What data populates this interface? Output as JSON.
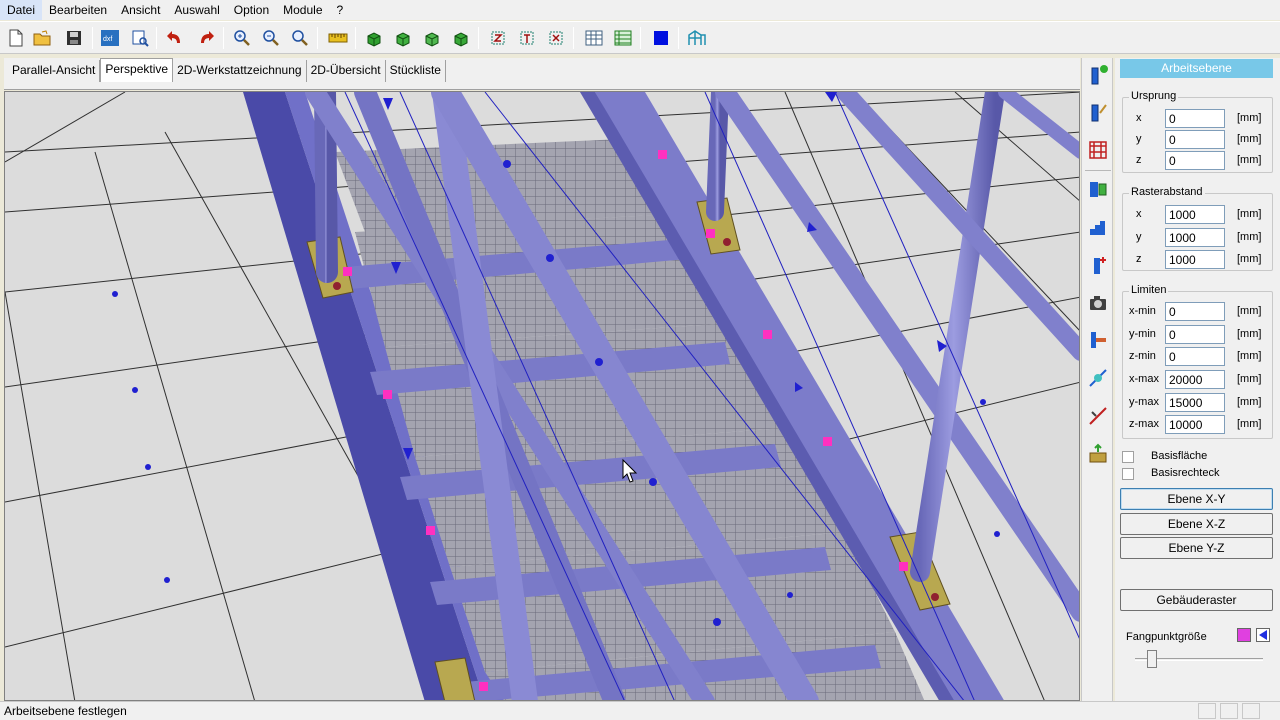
{
  "menu": [
    "Datei",
    "Bearbeiten",
    "Ansicht",
    "Auswahl",
    "Option",
    "Module",
    "?"
  ],
  "tabs": [
    {
      "label": "Parallel-Ansicht",
      "active": false
    },
    {
      "label": "Perspektive",
      "active": true
    },
    {
      "label": "2D-Werkstattzeichnung",
      "active": false
    },
    {
      "label": "2D-Übersicht",
      "active": false
    },
    {
      "label": "Stückliste",
      "active": false
    }
  ],
  "toolbar_icons": [
    "new-file-icon",
    "open-folder-icon",
    "save-icon",
    "dxf-export-icon",
    "print-preview-icon",
    "undo-icon",
    "redo-icon",
    "zoom-in-icon",
    "zoom-out-icon",
    "zoom-fit-icon",
    "measure-icon",
    "view-cube-1-icon",
    "view-cube-2-icon",
    "view-cube-3-icon",
    "view-cube-4-icon",
    "select-mode-1-icon",
    "select-mode-2-icon",
    "select-mode-3-icon",
    "table-grid-icon",
    "table-list-icon",
    "color-blue-icon",
    "structure-icon"
  ],
  "vertical_icons": [
    "beam-add-icon",
    "beam-edit-icon",
    "grid-icon",
    "profile-icon",
    "stair-icon",
    "column-add-icon",
    "camera-icon",
    "connection-icon",
    "snap-icon",
    "line-cut-icon",
    "export-icon"
  ],
  "panel": {
    "header": "Arbeitsebene",
    "origin": {
      "title": "Ursprung",
      "rows": [
        {
          "label": "x",
          "value": "0",
          "unit": "[mm]"
        },
        {
          "label": "y",
          "value": "0",
          "unit": "[mm]"
        },
        {
          "label": "z",
          "value": "0",
          "unit": "[mm]"
        }
      ]
    },
    "raster": {
      "title": "Rasterabstand",
      "rows": [
        {
          "label": "x",
          "value": "1000",
          "unit": "[mm]"
        },
        {
          "label": "y",
          "value": "1000",
          "unit": "[mm]"
        },
        {
          "label": "z",
          "value": "1000",
          "unit": "[mm]"
        }
      ]
    },
    "limits": {
      "title": "Limiten",
      "rows": [
        {
          "label": "x-min",
          "value": "0",
          "unit": "[mm]"
        },
        {
          "label": "y-min",
          "value": "0",
          "unit": "[mm]"
        },
        {
          "label": "z-min",
          "value": "0",
          "unit": "[mm]"
        },
        {
          "label": "x-max",
          "value": "20000",
          "unit": "[mm]"
        },
        {
          "label": "y-max",
          "value": "15000",
          "unit": "[mm]"
        },
        {
          "label": "z-max",
          "value": "10000",
          "unit": "[mm]"
        }
      ]
    },
    "checkboxes": [
      {
        "label": "Basisfläche",
        "checked": false
      },
      {
        "label": "Basisrechteck",
        "checked": false
      }
    ],
    "plane_buttons": [
      "Ebene X-Y",
      "Ebene X-Z",
      "Ebene Y-Z"
    ],
    "building_grid_button": "Gebäuderaster",
    "snap_size_label": "Fangpunktgröße",
    "snap_size_level": 0.15,
    "swatch_colors": [
      "#e040e0",
      "#2030e0"
    ]
  },
  "colors": {
    "steel": "#8080c8",
    "steel_dark": "#5a5aa8",
    "snap_point": "#ff30c0",
    "marker_blue": "#2020d0",
    "grating": "#9a9aa8",
    "floor": "#dcdcdc",
    "plate": "#b8a850"
  },
  "status": {
    "text": "Arbeitsebene festlegen"
  }
}
